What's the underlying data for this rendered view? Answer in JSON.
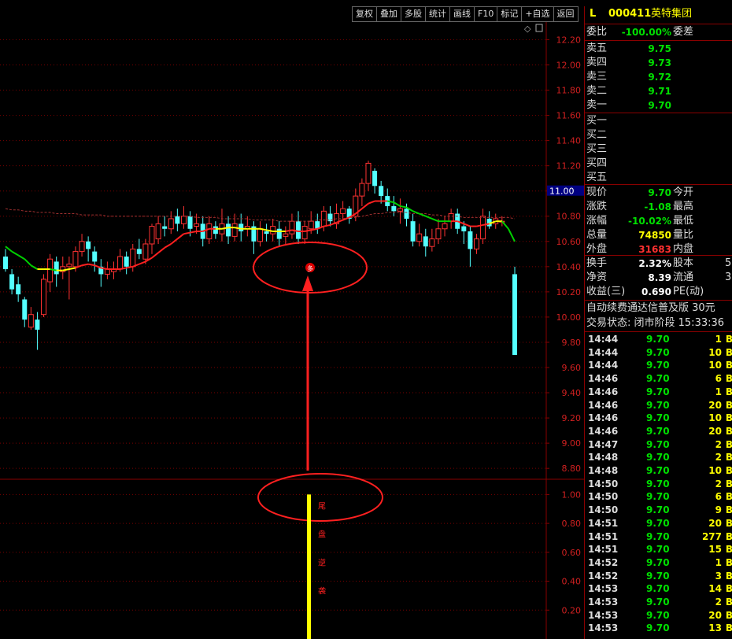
{
  "toolbar": {
    "buttons": [
      "复权",
      "叠加",
      "多股",
      "统计",
      "画线",
      "F10",
      "标记",
      "+自选",
      "返回"
    ]
  },
  "header": {
    "marker": "L",
    "code": "000411",
    "name": "英特集团"
  },
  "quote": {
    "weibi_label": "委比",
    "weibi_value": "-100.00%",
    "weicha_label": "委差",
    "asks": [
      {
        "label": "卖五",
        "price": "9.75"
      },
      {
        "label": "卖四",
        "price": "9.73"
      },
      {
        "label": "卖三",
        "price": "9.72"
      },
      {
        "label": "卖二",
        "price": "9.71"
      },
      {
        "label": "卖一",
        "price": "9.70"
      }
    ],
    "bids": [
      {
        "label": "买一"
      },
      {
        "label": "买二"
      },
      {
        "label": "买三"
      },
      {
        "label": "买四"
      },
      {
        "label": "买五"
      }
    ],
    "stats": [
      {
        "label": "现价",
        "value": "9.70",
        "color": "green",
        "label2": "今开"
      },
      {
        "label": "涨跌",
        "value": "-1.08",
        "color": "green",
        "label2": "最高"
      },
      {
        "label": "涨幅",
        "value": "-10.02%",
        "color": "green",
        "label2": "最低"
      },
      {
        "label": "总量",
        "value": "74850",
        "color": "yellow",
        "label2": "量比"
      },
      {
        "label": "外盘",
        "value": "31683",
        "color": "red",
        "label2": "内盘"
      }
    ],
    "stats2": [
      {
        "label": "换手",
        "value": "2.32%",
        "label2": "股本",
        "trail": "5"
      },
      {
        "label": "净资",
        "value": "8.39",
        "label2": "流通",
        "trail": "3"
      },
      {
        "label": "收益(三)",
        "value": "0.690",
        "label2": "PE(动)",
        "trail": ""
      }
    ],
    "ad_text": "自动续费通达信普及版  30元",
    "status_text": "交易状态: 闭市阶段 15:33:36"
  },
  "ticks": [
    {
      "time": "14:44",
      "price": "9.70",
      "vol": "1"
    },
    {
      "time": "14:44",
      "price": "9.70",
      "vol": "10"
    },
    {
      "time": "14:44",
      "price": "9.70",
      "vol": "10"
    },
    {
      "time": "14:46",
      "price": "9.70",
      "vol": "6"
    },
    {
      "time": "14:46",
      "price": "9.70",
      "vol": "1"
    },
    {
      "time": "14:46",
      "price": "9.70",
      "vol": "20"
    },
    {
      "time": "14:46",
      "price": "9.70",
      "vol": "10"
    },
    {
      "time": "14:46",
      "price": "9.70",
      "vol": "20"
    },
    {
      "time": "14:47",
      "price": "9.70",
      "vol": "2"
    },
    {
      "time": "14:48",
      "price": "9.70",
      "vol": "2"
    },
    {
      "time": "14:48",
      "price": "9.70",
      "vol": "10"
    },
    {
      "time": "14:50",
      "price": "9.70",
      "vol": "2"
    },
    {
      "time": "14:50",
      "price": "9.70",
      "vol": "6"
    },
    {
      "time": "14:50",
      "price": "9.70",
      "vol": "9"
    },
    {
      "time": "14:51",
      "price": "9.70",
      "vol": "20"
    },
    {
      "time": "14:51",
      "price": "9.70",
      "vol": "277"
    },
    {
      "time": "14:51",
      "price": "9.70",
      "vol": "15"
    },
    {
      "time": "14:52",
      "price": "9.70",
      "vol": "1"
    },
    {
      "time": "14:52",
      "price": "9.70",
      "vol": "3"
    },
    {
      "time": "14:53",
      "price": "9.70",
      "vol": "14"
    },
    {
      "time": "14:53",
      "price": "9.70",
      "vol": "2"
    },
    {
      "time": "14:53",
      "price": "9.70",
      "vol": "20"
    },
    {
      "time": "14:53",
      "price": "9.70",
      "vol": "13"
    }
  ],
  "tick_flag": "B",
  "chart_data": {
    "type": "candlestick",
    "price_axis": {
      "ticks": [
        "12.20",
        "12.00",
        "11.80",
        "11.60",
        "11.40",
        "11.20",
        "11.00",
        "10.80",
        "10.60",
        "10.40",
        "10.20",
        "10.00",
        "9.80",
        "9.60",
        "9.40",
        "9.20",
        "9.00",
        "8.80"
      ],
      "range": [
        8.72,
        12.34
      ],
      "current_label": "11.00"
    },
    "indicator_axis": {
      "ticks": [
        "1.00",
        "0.80",
        "0.60",
        "0.40",
        "0.20"
      ],
      "range": [
        0,
        1.1
      ]
    },
    "signal_mark": "多",
    "indicator_text": [
      "尾",
      "盘",
      "逆",
      "袭"
    ],
    "indicator_value": 1.0,
    "candles": [
      [
        10.48,
        10.38,
        10.54,
        10.36
      ],
      [
        10.34,
        10.22,
        10.38,
        10.18
      ],
      [
        10.26,
        10.18,
        10.32,
        10.12
      ],
      [
        10.14,
        9.98,
        10.16,
        9.92
      ],
      [
        9.92,
        10.02,
        10.08,
        9.9
      ],
      [
        9.98,
        9.9,
        10.04,
        9.74
      ],
      [
        10.02,
        10.3,
        10.34,
        10.0
      ],
      [
        10.28,
        10.46,
        10.5,
        10.2
      ],
      [
        10.44,
        10.34,
        10.48,
        10.24
      ],
      [
        10.36,
        10.4,
        10.48,
        10.3
      ],
      [
        10.4,
        10.42,
        10.48,
        10.14
      ],
      [
        10.4,
        10.52,
        10.56,
        10.36
      ],
      [
        10.52,
        10.6,
        10.66,
        10.48
      ],
      [
        10.6,
        10.54,
        10.64,
        10.44
      ],
      [
        10.52,
        10.44,
        10.56,
        10.36
      ],
      [
        10.4,
        10.34,
        10.46,
        10.24
      ],
      [
        10.34,
        10.38,
        10.44,
        10.3
      ],
      [
        10.36,
        10.38,
        10.44,
        10.3
      ],
      [
        10.38,
        10.48,
        10.54,
        10.36
      ],
      [
        10.48,
        10.4,
        10.52,
        10.34
      ],
      [
        10.4,
        10.54,
        10.58,
        10.36
      ],
      [
        10.54,
        10.5,
        10.62,
        10.46
      ],
      [
        10.46,
        10.58,
        10.62,
        10.42
      ],
      [
        10.58,
        10.72,
        10.74,
        10.5
      ],
      [
        10.62,
        10.74,
        10.8,
        10.58
      ],
      [
        10.72,
        10.7,
        10.8,
        10.64
      ],
      [
        10.7,
        10.78,
        10.84,
        10.66
      ],
      [
        10.8,
        10.74,
        10.86,
        10.68
      ],
      [
        10.74,
        10.8,
        10.88,
        10.7
      ],
      [
        10.8,
        10.7,
        10.84,
        10.64
      ],
      [
        10.72,
        10.74,
        10.82,
        10.66
      ],
      [
        10.74,
        10.62,
        10.8,
        10.56
      ],
      [
        10.62,
        10.74,
        10.8,
        10.58
      ],
      [
        10.72,
        10.66,
        10.76,
        10.62
      ],
      [
        10.66,
        10.74,
        10.86,
        10.6
      ],
      [
        10.74,
        10.64,
        10.8,
        10.58
      ],
      [
        10.64,
        10.74,
        10.82,
        10.6
      ],
      [
        10.74,
        10.68,
        10.82,
        10.6
      ],
      [
        10.7,
        10.72,
        10.8,
        10.64
      ],
      [
        10.72,
        10.6,
        10.76,
        10.5
      ],
      [
        10.6,
        10.7,
        10.76,
        10.56
      ],
      [
        10.68,
        10.66,
        10.74,
        10.6
      ],
      [
        10.66,
        10.72,
        10.78,
        10.6
      ],
      [
        10.7,
        10.62,
        10.76,
        10.56
      ],
      [
        10.64,
        10.66,
        10.72,
        10.58
      ],
      [
        10.66,
        10.76,
        10.82,
        10.62
      ],
      [
        10.76,
        10.62,
        10.84,
        10.58
      ],
      [
        10.62,
        10.72,
        10.76,
        10.58
      ],
      [
        10.7,
        10.76,
        10.84,
        10.66
      ],
      [
        10.76,
        10.7,
        10.82,
        10.66
      ],
      [
        10.72,
        10.84,
        10.88,
        10.68
      ],
      [
        10.82,
        10.76,
        10.88,
        10.72
      ],
      [
        10.74,
        10.82,
        10.9,
        10.7
      ],
      [
        10.82,
        10.86,
        10.92,
        10.78
      ],
      [
        10.86,
        10.78,
        10.88,
        10.74
      ],
      [
        10.8,
        10.96,
        11.02,
        10.76
      ],
      [
        10.96,
        11.06,
        11.1,
        10.88
      ],
      [
        11.06,
        11.22,
        11.24,
        11.0
      ],
      [
        11.16,
        11.04,
        11.18,
        10.98
      ],
      [
        11.04,
        10.96,
        11.08,
        10.9
      ],
      [
        10.96,
        10.88,
        11.02,
        10.84
      ],
      [
        10.88,
        10.84,
        10.96,
        10.8
      ],
      [
        10.84,
        10.86,
        10.94,
        10.74
      ],
      [
        10.86,
        10.78,
        10.9,
        10.72
      ],
      [
        10.76,
        10.6,
        10.82,
        10.56
      ],
      [
        10.6,
        10.66,
        10.74,
        10.56
      ],
      [
        10.64,
        10.56,
        10.7,
        10.48
      ],
      [
        10.56,
        10.62,
        10.7,
        10.52
      ],
      [
        10.62,
        10.7,
        10.78,
        10.58
      ],
      [
        10.7,
        10.74,
        10.8,
        10.64
      ],
      [
        10.76,
        10.82,
        10.86,
        10.7
      ],
      [
        10.82,
        10.7,
        10.86,
        10.66
      ],
      [
        10.72,
        10.68,
        10.76,
        10.58
      ],
      [
        10.68,
        10.54,
        10.72,
        10.4
      ],
      [
        10.54,
        10.62,
        10.66,
        10.5
      ],
      [
        10.62,
        10.8,
        10.86,
        10.58
      ],
      [
        10.78,
        10.72,
        10.84,
        10.7
      ],
      [
        10.74,
        10.78,
        10.82,
        10.7
      ],
      [
        10.76,
        10.76,
        10.8,
        10.72
      ],
      [
        null,
        null,
        null,
        null
      ],
      [
        10.34,
        9.7,
        10.4,
        9.7
      ]
    ],
    "ma_line": [
      10.56,
      10.52,
      10.49,
      10.46,
      10.41,
      10.38,
      10.38,
      10.38,
      10.37,
      10.37,
      10.38,
      10.39,
      10.41,
      10.42,
      10.41,
      10.39,
      10.38,
      10.38,
      10.38,
      10.39,
      10.4,
      10.42,
      10.44,
      10.47,
      10.51,
      10.55,
      10.58,
      10.62,
      10.66,
      10.67,
      10.68,
      10.68,
      10.7,
      10.7,
      10.7,
      10.71,
      10.71,
      10.7,
      10.7,
      10.7,
      10.7,
      10.69,
      10.68,
      10.68,
      10.68,
      10.69,
      10.68,
      10.68,
      10.69,
      10.7,
      10.72,
      10.73,
      10.75,
      10.77,
      10.79,
      10.82,
      10.86,
      10.9,
      10.92,
      10.92,
      10.92,
      10.91,
      10.88,
      10.87,
      10.84,
      10.82,
      10.8,
      10.78,
      10.76,
      10.76,
      10.76,
      10.76,
      10.74,
      10.72,
      10.72,
      10.73,
      10.74,
      10.76,
      10.76,
      10.7,
      10.6
    ],
    "ma_colors": [
      "#00d000",
      "#ffff00",
      "#ff2020"
    ],
    "dashed_ma": [
      10.86,
      10.85,
      10.85,
      10.84,
      10.84,
      10.83,
      10.83,
      10.83,
      10.82,
      10.82,
      10.82,
      10.82,
      10.81,
      10.81,
      10.81,
      10.81,
      10.8,
      10.8,
      10.8,
      10.8,
      10.8,
      10.8,
      10.8,
      10.8,
      10.8,
      10.8,
      10.8,
      10.8,
      10.8,
      10.8,
      10.79,
      10.79,
      10.79,
      10.79,
      10.78,
      10.78,
      10.78,
      10.78,
      10.78,
      10.77,
      10.77,
      10.77,
      10.77,
      10.76,
      10.76,
      10.76,
      10.76,
      10.76,
      10.76,
      10.77,
      10.77,
      10.77,
      10.78,
      10.78,
      10.79,
      10.79,
      10.8,
      10.81,
      10.82,
      10.82,
      10.83,
      10.83,
      10.83,
      10.83,
      10.82,
      10.82,
      10.82,
      10.81,
      10.81,
      10.8,
      10.8,
      10.8,
      10.79,
      10.79,
      10.79,
      10.79,
      10.79,
      10.79,
      10.79,
      10.79,
      10.78
    ]
  }
}
